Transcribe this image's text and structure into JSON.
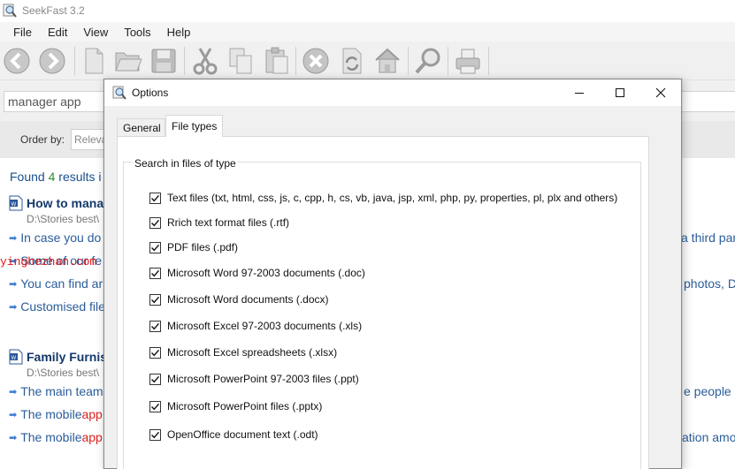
{
  "app": {
    "title": "SeekFast 3.2",
    "menu": [
      "File",
      "Edit",
      "View",
      "Tools",
      "Help"
    ],
    "toolbar_icons": [
      "back-icon",
      "forward-icon",
      "new-file-icon",
      "open-folder-icon",
      "save-icon",
      "cut-icon",
      "copy-icon",
      "paste-icon",
      "stop-icon",
      "refresh-icon",
      "home-icon",
      "search-icon",
      "print-icon"
    ]
  },
  "search": {
    "value": "manager app"
  },
  "order": {
    "label": "Order by:",
    "selected": "Releva"
  },
  "results": {
    "found_prefix": "Found ",
    "found_count": "4",
    "found_suffix": " results i",
    "items": [
      {
        "title": "How to mana",
        "path": "D:\\Stories best\\",
        "snippets": [
          {
            "text": "In case you do",
            "right": "a third par"
          },
          {
            "text": "Some of our fe",
            "right": ""
          },
          {
            "text": "You can find ar",
            "right": "photos, D"
          },
          {
            "text": "Customised file",
            "right": ""
          }
        ]
      },
      {
        "title": "Family Furnis",
        "path": "D:\\Stories best\\",
        "snippets": [
          {
            "pre": "The main team",
            "hl": "",
            "right": "e people i"
          },
          {
            "pre": "The mobile ",
            "hl": "app",
            "right": ""
          },
          {
            "pre": "The mobile ",
            "hl": "app",
            "right": "ation amo"
          }
        ]
      }
    ],
    "watermark": "yinghezhan.com"
  },
  "dialog": {
    "title": "Options",
    "tabs": [
      {
        "label": "General",
        "active": false
      },
      {
        "label": "File types",
        "active": true
      }
    ],
    "group_label": "Search in files of type",
    "file_types": [
      {
        "label": "Text files (txt, html, css, js, c, cpp, h, cs, vb, java, jsp, xml, php, py, properties, pl, plx and others)",
        "checked": true
      },
      {
        "label": "Rrich text format files (.rtf)",
        "checked": true
      },
      {
        "label": "PDF files (.pdf)",
        "checked": true
      },
      {
        "label": "Microsoft Word 97-2003 documents (.doc)",
        "checked": true
      },
      {
        "label": "Microsoft Word documents (.docx)",
        "checked": true
      },
      {
        "label": "Microsoft Excel 97-2003 documents (.xls)",
        "checked": true
      },
      {
        "label": "Microsoft Excel spreadsheets (.xlsx)",
        "checked": true
      },
      {
        "label": "Microsoft PowerPoint 97-2003 files (.ppt)",
        "checked": true
      },
      {
        "label": "Microsoft PowerPoint files (.pptx)",
        "checked": true
      },
      {
        "label": "OpenOffice document text (.odt)",
        "checked": true
      }
    ]
  },
  "colors": {
    "accent_link": "#2a5c9a",
    "title_dark": "#14386b",
    "highlight": "#e02020",
    "count_green": "#2e8b2e"
  }
}
